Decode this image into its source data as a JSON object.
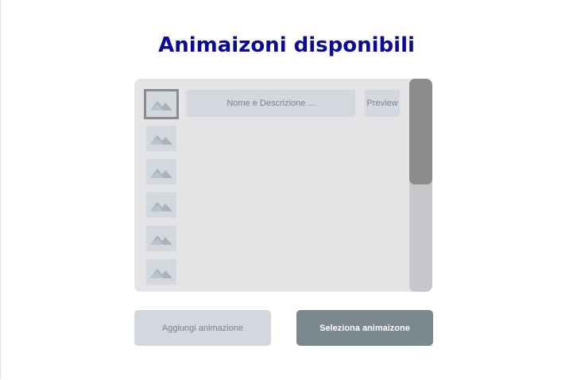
{
  "page": {
    "title": "Animaizoni disponibili"
  },
  "list": {
    "name_placeholder": "Nome e Descrizione ...",
    "preview_label": "Preview",
    "thumb_icon": "image-placeholder-icon",
    "scroll_position": 0
  },
  "actions": {
    "add_label": "Aggiungi animazione",
    "select_label": "Seleziona animaizone"
  },
  "colors": {
    "title": "#0a0a9a",
    "panel_bg": "#e4e4e6",
    "placeholder_bg": "#d2d8de",
    "primary_button": "#7a888e",
    "scroll_thumb": "#8c8c8c"
  }
}
